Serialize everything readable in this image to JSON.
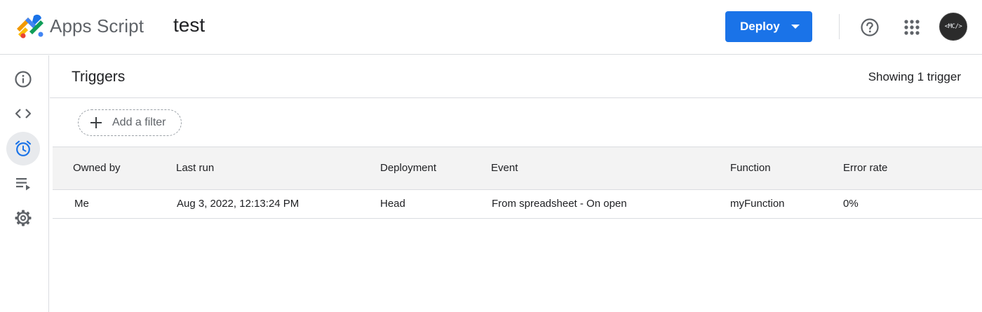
{
  "header": {
    "app_name": "Apps Script",
    "project_name": "test",
    "deploy_label": "Deploy",
    "avatar_text": "<MC/>",
    "accent_color": "#1a73e8"
  },
  "sidebar": {
    "items": [
      {
        "name": "overview",
        "icon": "info-icon"
      },
      {
        "name": "editor",
        "icon": "code-icon"
      },
      {
        "name": "triggers",
        "icon": "alarm-clock-icon",
        "active": true
      },
      {
        "name": "executions",
        "icon": "playlist-play-icon"
      },
      {
        "name": "settings",
        "icon": "gear-icon"
      }
    ]
  },
  "main": {
    "title": "Triggers",
    "count_text": "Showing 1 trigger",
    "filter_label": "Add a filter",
    "table": {
      "columns": [
        "Owned by",
        "Last run",
        "Deployment",
        "Event",
        "Function",
        "Error rate"
      ],
      "rows": [
        [
          "Me",
          "Aug 3, 2022, 12:13:24 PM",
          "Head",
          "From spreadsheet - On open",
          "myFunction",
          "0%"
        ]
      ]
    }
  }
}
